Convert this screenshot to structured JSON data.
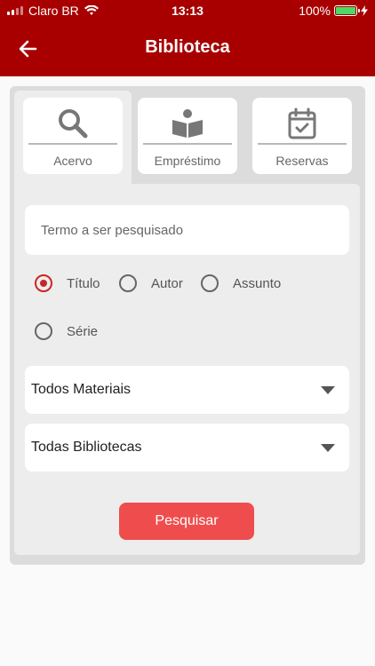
{
  "status": {
    "carrier": "Claro BR",
    "time": "13:13",
    "battery": "100%"
  },
  "header": {
    "title": "Biblioteca"
  },
  "tabs": [
    {
      "label": "Acervo",
      "icon": "search-icon"
    },
    {
      "label": "Empréstimo",
      "icon": "book-reader-icon"
    },
    {
      "label": "Reservas",
      "icon": "calendar-check-icon"
    }
  ],
  "search": {
    "placeholder": "Termo a ser pesquisado"
  },
  "radios": [
    {
      "label": "Título",
      "checked": true
    },
    {
      "label": "Autor",
      "checked": false
    },
    {
      "label": "Assunto",
      "checked": false
    },
    {
      "label": "Série",
      "checked": false
    }
  ],
  "selects": [
    {
      "value": "Todos Materiais"
    },
    {
      "value": "Todas Bibliotecas"
    }
  ],
  "button": {
    "label": "Pesquisar"
  },
  "colors": {
    "header": "#a80000",
    "accent": "#c62828",
    "button": "#ef4d4d"
  }
}
